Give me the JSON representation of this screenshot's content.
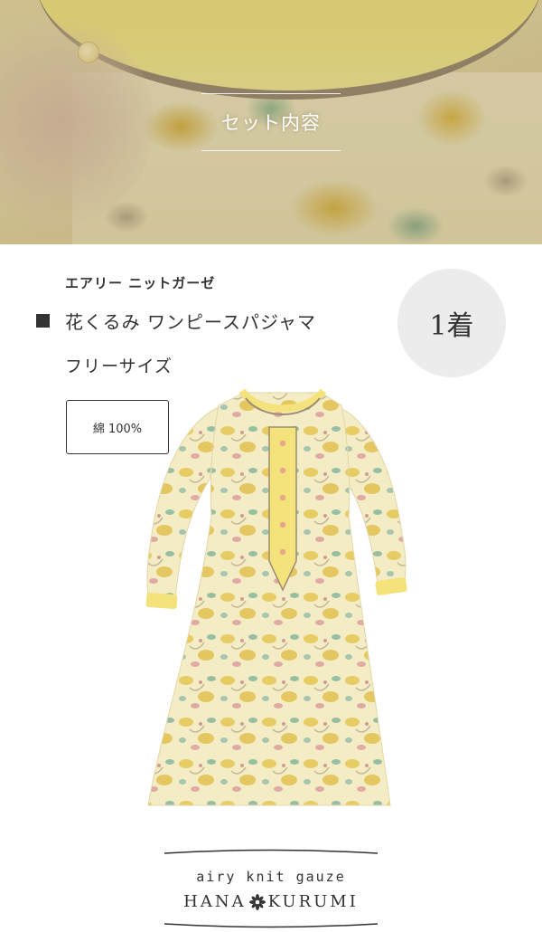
{
  "hero": {
    "title": "セット内容"
  },
  "product": {
    "series": "エアリー ニットガーゼ",
    "name": "花くるみ ワンピースパジャマ",
    "size": "フリーサイズ",
    "quantity": "1着",
    "material": "綿 100%"
  },
  "logo": {
    "tagline": "airy knit gauze",
    "brand_left": "HANA",
    "brand_right": "KURUMI",
    "flower_icon": "flower-icon"
  },
  "colors": {
    "text": "#333333",
    "circle_bg": "#ececec",
    "dress_yellow": "#f1e59a",
    "trim_yellow": "#f4e27a"
  }
}
